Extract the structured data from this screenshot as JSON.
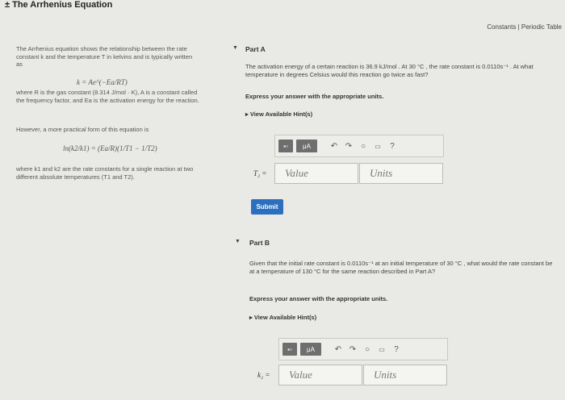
{
  "header": {
    "title": "± The Arrhenius Equation",
    "constants_link": "Constants",
    "separator": " | ",
    "periodic_link": "Periodic Table"
  },
  "intro": {
    "p1": "The Arrhenius equation shows the relationship between the rate constant k and the temperature T in kelvins and is typically written as",
    "formula1": "k = Ae^(−Ea/RT)",
    "p2": "where R is the gas constant (8.314 J/mol · K), A is a constant called the frequency factor, and Ea is the activation energy for the reaction.",
    "p3": "However, a more practical form of this equation is",
    "formula2": "ln(k2/k1) = (Ea/R)(1/T1 − 1/T2)",
    "p4": "where k1 and k2 are the rate constants for a single reaction at two different absolute temperatures (T1 and T2)."
  },
  "partA": {
    "label": "Part A",
    "question": "The activation energy of a certain reaction is 36.9 kJ/mol . At 30 °C , the rate constant is 0.0110s⁻¹ . At what temperature in degrees Celsius would this reaction go twice as fast?",
    "instruction": "Express your answer with the appropriate units.",
    "hint": "View Available Hint(s)",
    "var_label": "T₂ =",
    "value_placeholder": "Value",
    "units_placeholder": "Units",
    "submit": "Submit"
  },
  "partB": {
    "label": "Part B",
    "question": "Given that the initial rate constant is 0.0110s⁻¹ at an initial temperature of 30 °C , what would the rate constant be at a temperature of 130 °C for the same reaction described in Part A?",
    "instruction": "Express your answer with the appropriate units.",
    "hint": "View Available Hint(s)",
    "var_label": "k₂ =",
    "value_placeholder": "Value",
    "units_placeholder": "Units"
  },
  "toolbar": {
    "mu_label": "μA",
    "help_label": "?"
  },
  "icons": [
    "templates-icon",
    "units-icon",
    "undo-icon",
    "redo-icon",
    "reset-icon",
    "keyboard-icon",
    "help-icon"
  ]
}
